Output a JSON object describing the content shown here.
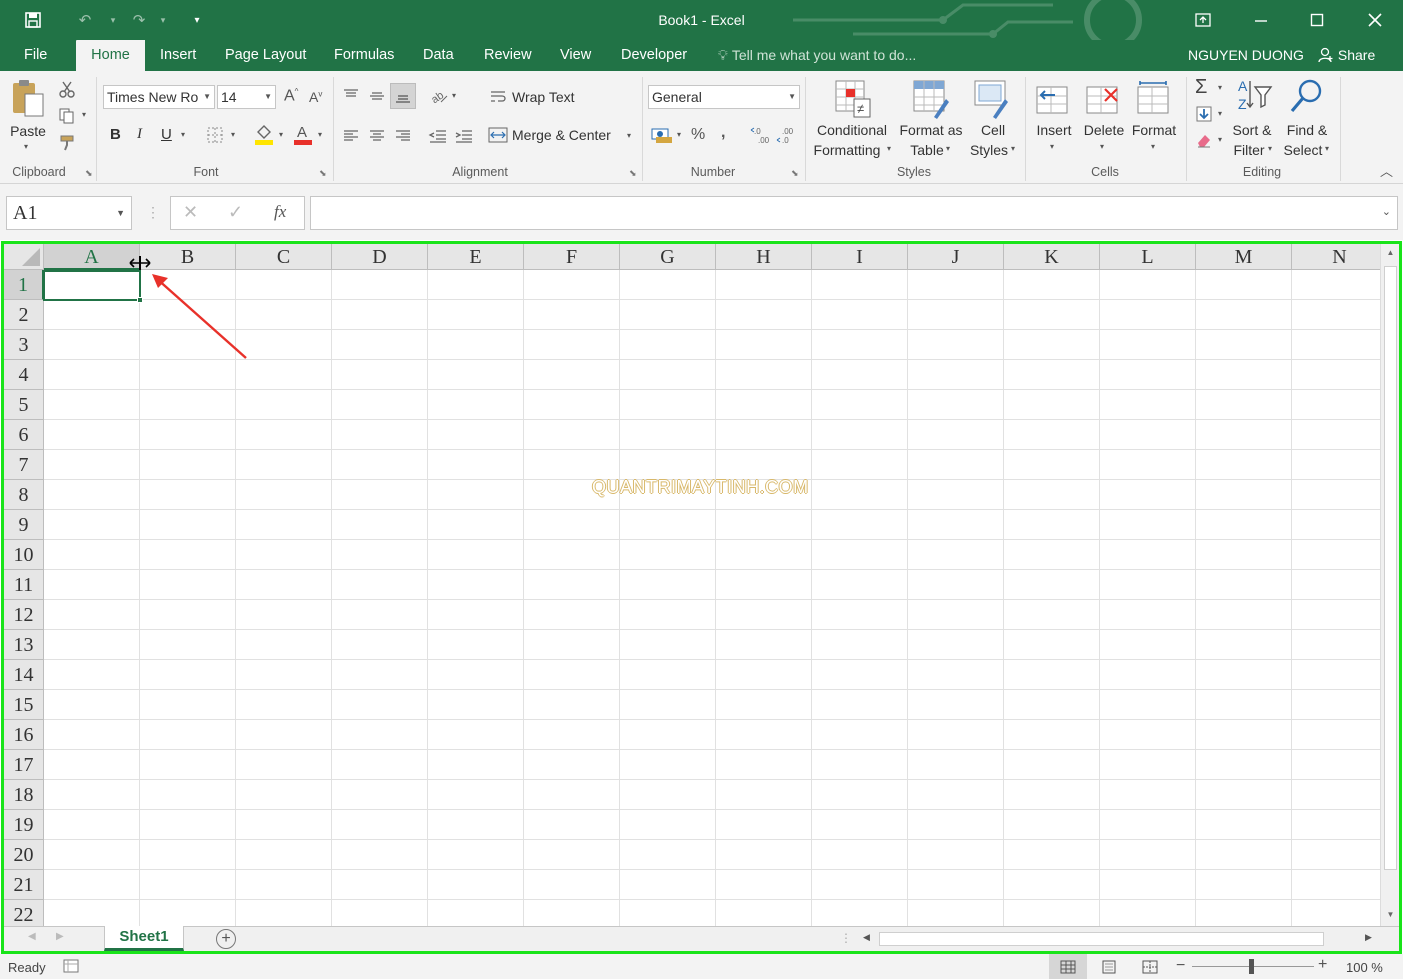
{
  "window": {
    "title": "Book1 - Excel",
    "user": "NGUYEN DUONG",
    "share": "Share"
  },
  "tabs": [
    "File",
    "Home",
    "Insert",
    "Page Layout",
    "Formulas",
    "Data",
    "Review",
    "View",
    "Developer"
  ],
  "active_tab": "Home",
  "tell_me": "Tell me what you want to do...",
  "ribbon": {
    "clipboard": {
      "paste": "Paste",
      "label": "Clipboard"
    },
    "font": {
      "name": "Times New Ro",
      "size": "14",
      "bold": "B",
      "italic": "I",
      "underline": "U",
      "label": "Font"
    },
    "alignment": {
      "wrap": "Wrap Text",
      "merge": "Merge & Center",
      "label": "Alignment"
    },
    "number": {
      "format": "General",
      "percent": "%",
      "comma": ",",
      "label": "Number"
    },
    "styles": {
      "conditional_1": "Conditional",
      "conditional_2": "Formatting",
      "format_table_1": "Format as",
      "format_table_2": "Table",
      "cell_styles_1": "Cell",
      "cell_styles_2": "Styles",
      "label": "Styles"
    },
    "cells": {
      "insert": "Insert",
      "delete": "Delete",
      "format": "Format",
      "label": "Cells"
    },
    "editing": {
      "sort_1": "Sort &",
      "sort_2": "Filter",
      "find_1": "Find &",
      "find_2": "Select",
      "label": "Editing"
    }
  },
  "formula_bar": {
    "name_box": "A1",
    "fx": "fx",
    "value": ""
  },
  "columns": [
    "A",
    "B",
    "C",
    "D",
    "E",
    "F",
    "G",
    "H",
    "I",
    "J",
    "K",
    "L",
    "M",
    "N"
  ],
  "rows": [
    "1",
    "2",
    "3",
    "4",
    "5",
    "6",
    "7",
    "8",
    "9",
    "10",
    "11",
    "12",
    "13",
    "14",
    "15",
    "16",
    "17",
    "18",
    "19",
    "20",
    "21",
    "22"
  ],
  "active_cell": "A1",
  "watermark": "QUANTRIMAYTINH.COM",
  "sheets": [
    "Sheet1"
  ],
  "status": {
    "ready": "Ready",
    "zoom": "100 %"
  },
  "colors": {
    "excel_green": "#217346",
    "highlight_border": "#19e419",
    "annotation_arrow": "#e8312a"
  }
}
